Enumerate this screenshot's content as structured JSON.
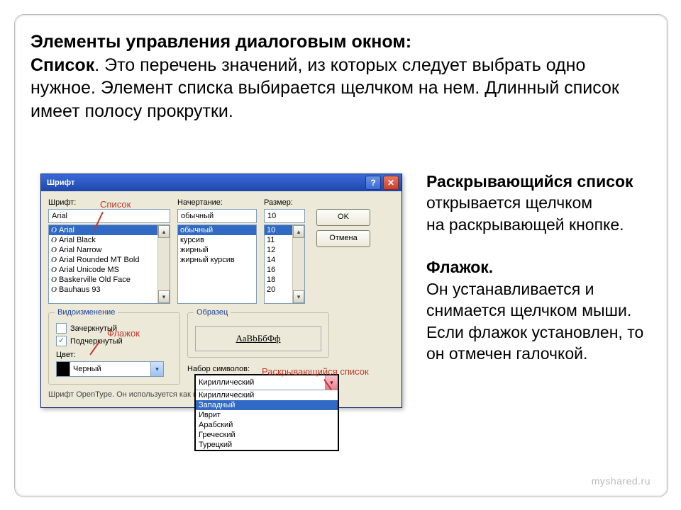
{
  "heading": {
    "line1_bold": "Элементы управления диалоговым окном:",
    "line2_bold": "Список",
    "line2_rest": ". Это перечень значений, из которых следует выбрать одно нужное. Элемент списка выбирается щелчком на нем. Длинный список имеет полосу прокрутки."
  },
  "right": {
    "p1_bold": "Раскрывающийся список",
    "p1_rest": " открывается щелчком",
    "p1_line2": " на раскрывающей кнопке.",
    "p2_bold": "Флажок.",
    "p2_rest": " Он устанавливается и снимается щелчком мыши. Если флажок установлен, то он отмечен галочкой."
  },
  "dialog": {
    "title": "Шрифт",
    "font_label": "Шрифт:",
    "font_value": "Arial",
    "fonts": [
      "Arial",
      "Arial Black",
      "Arial Narrow",
      "Arial Rounded MT Bold",
      "Arial Unicode MS",
      "Baskerville Old Face",
      "Bauhaus 93"
    ],
    "style_label": "Начертание:",
    "style_value": "обычный",
    "styles": [
      "обычный",
      "курсив",
      "жирный",
      "жирный курсив"
    ],
    "size_label": "Размер:",
    "size_value": "10",
    "sizes": [
      "10",
      "11",
      "12",
      "14",
      "16",
      "18",
      "20"
    ],
    "ok": "OK",
    "cancel": "Отмена",
    "effects_legend": "Видоизменение",
    "strike_label": "Зачеркнутый",
    "underline_label": "Подчеркнутый",
    "color_label": "Цвет:",
    "color_value": "Черный",
    "sample_legend": "Образец",
    "sample_text": "АаBbБбФф",
    "charset_label": "Набор символов:",
    "charset_value": "Кириллический",
    "charsets": [
      "Кириллический",
      "Западный",
      "Иврит",
      "Арабский",
      "Греческий",
      "Турецкий"
    ],
    "footnote": "Шрифт OpenType. Он используется как на экране, так и на принтер."
  },
  "callouts": {
    "list": "Список",
    "checkbox": "Флажок",
    "dropdown": "Раскрывающийся список"
  },
  "watermark": "myshared.ru"
}
